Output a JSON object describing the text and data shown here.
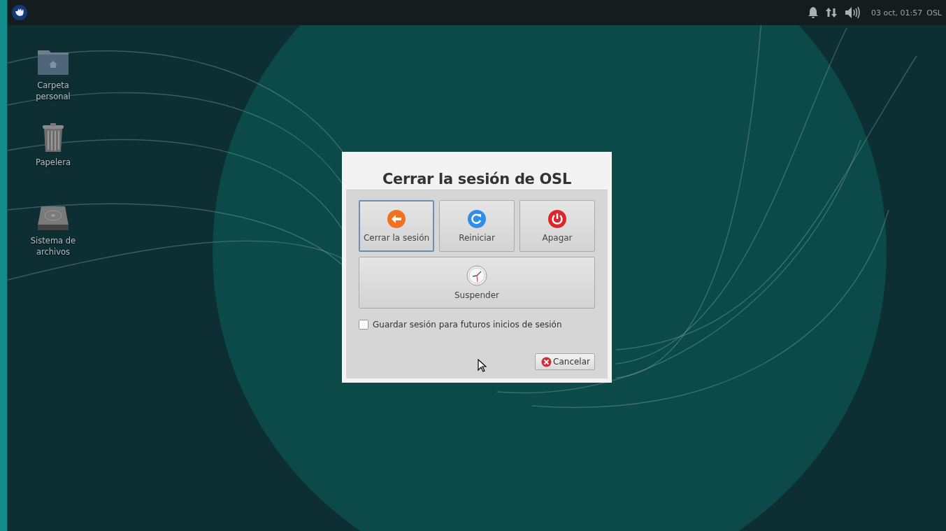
{
  "panel": {
    "clock": "03 oct, 01:57",
    "user": "OSL"
  },
  "desktop_icons": [
    {
      "kind": "home-folder",
      "label": "Carpeta personal"
    },
    {
      "kind": "trash",
      "label": "Papelera"
    },
    {
      "kind": "drive",
      "label": "Sistema de archivos"
    }
  ],
  "dialog": {
    "title": "Cerrar la sesión de OSL",
    "actions": [
      {
        "kind": "logout",
        "label": "Cerrar la sesión",
        "selected": true
      },
      {
        "kind": "restart",
        "label": "Reiniciar",
        "selected": false
      },
      {
        "kind": "shutdown",
        "label": "Apagar",
        "selected": false
      },
      {
        "kind": "suspend",
        "label": "Suspender",
        "selected": false
      }
    ],
    "save_session": {
      "label": "Guardar sesión para futuros inicios de sesión",
      "checked": false
    },
    "cancel": "Cancelar"
  }
}
